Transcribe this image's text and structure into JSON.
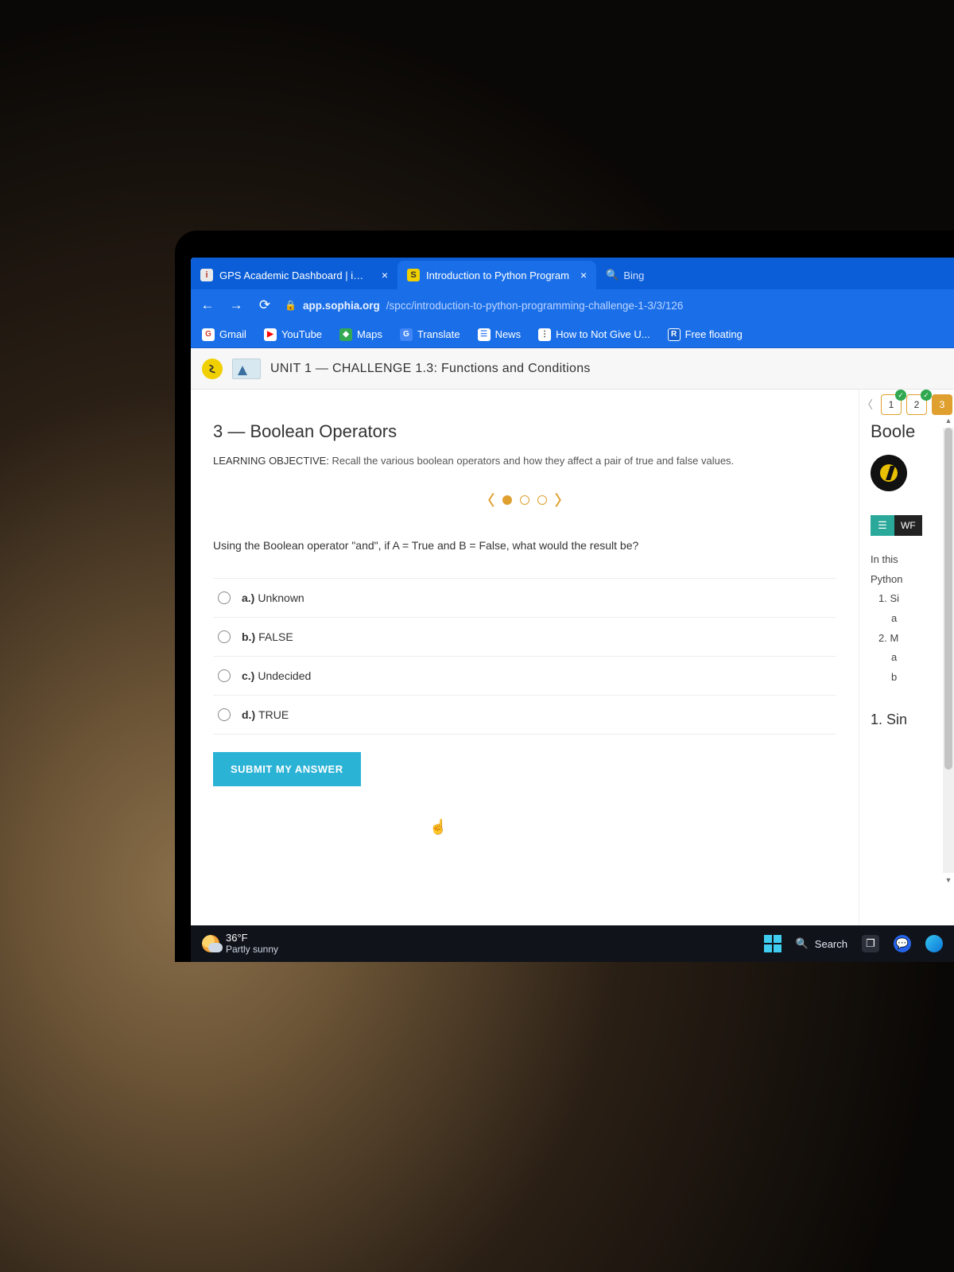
{
  "tabs": [
    {
      "title": "GPS Academic Dashboard | iCam",
      "fav_bg": "#e9e9e9",
      "fav_fg": "#c0392b",
      "fav_txt": "i"
    },
    {
      "title": "Introduction to Python Program",
      "fav_bg": "#f0d000",
      "fav_fg": "#333",
      "fav_txt": "S"
    }
  ],
  "tab_search": "Bing",
  "url": {
    "host": "app.sophia.org",
    "path": "/spcc/introduction-to-python-programming-challenge-1-3/3/126"
  },
  "bookmarks": [
    {
      "label": "Gmail",
      "bg": "#fff",
      "fg": "#d23c2a",
      "txt": "G"
    },
    {
      "label": "YouTube",
      "bg": "#fff",
      "fg": "#ff0000",
      "txt": "▶"
    },
    {
      "label": "Maps",
      "bg": "#34a853",
      "fg": "#fff",
      "txt": "◆"
    },
    {
      "label": "Translate",
      "bg": "#4285f4",
      "fg": "#fff",
      "txt": "G"
    },
    {
      "label": "News",
      "bg": "#fff",
      "fg": "#4285f4",
      "txt": "☰"
    },
    {
      "label": "How to Not Give U...",
      "bg": "#fff",
      "fg": "#333",
      "txt": "⋮"
    },
    {
      "label": "Free floating",
      "bg": "#1560d0",
      "fg": "#fff",
      "txt": "R"
    }
  ],
  "unit_title": "UNIT 1 — CHALLENGE 1.3: Functions and Conditions",
  "pager": [
    "1",
    "2",
    "3"
  ],
  "section_title": "3 — Boolean Operators",
  "learning_objective": {
    "label": "LEARNING OBJECTIVE:",
    "text": " Recall the various boolean operators and how they affect a pair of true and false values."
  },
  "question": "Using the Boolean operator \"and\", if A = True and B = False, what would the result be?",
  "options": [
    {
      "key": "a.)",
      "text": "Unknown"
    },
    {
      "key": "b.)",
      "text": "FALSE"
    },
    {
      "key": "c.)",
      "text": "Undecided"
    },
    {
      "key": "d.)",
      "text": "TRUE"
    }
  ],
  "submit_label": "SUBMIT MY ANSWER",
  "right": {
    "title": "Boole",
    "wf": "WF",
    "intro": "In this",
    "l1": "Python",
    "l2": "1. Si",
    "l2a": "a",
    "l3": "2. M",
    "l3a": "a",
    "l3b": "b",
    "footer": "1. Sin"
  },
  "taskbar": {
    "temp": "36°F",
    "desc": "Partly sunny",
    "search": "Search"
  }
}
